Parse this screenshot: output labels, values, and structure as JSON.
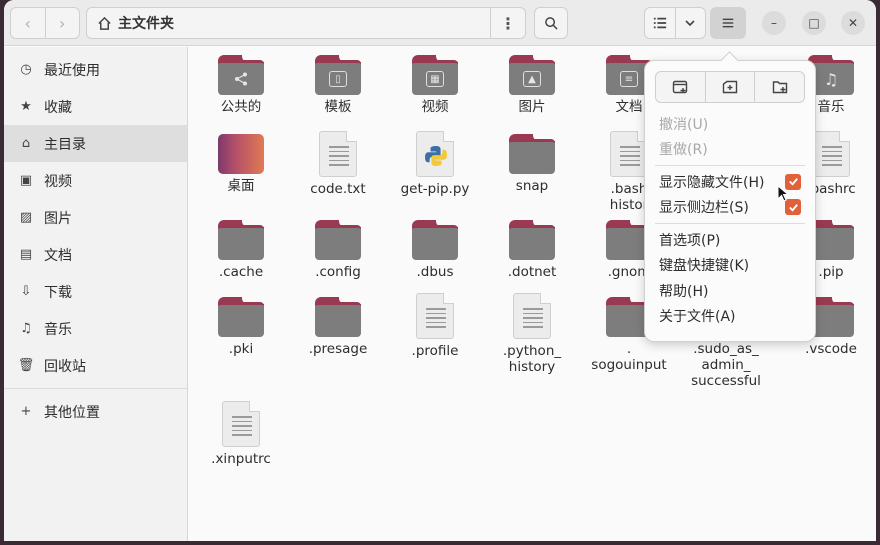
{
  "header": {
    "back_icon": "chevron-left-icon",
    "forward_icon": "chevron-right-icon",
    "path_title": "主文件夹",
    "path_more": "⋮",
    "search_icon": "search-icon",
    "view_icon": "list-view-icon",
    "view_dropdown_icon": "chevron-down-icon",
    "menu_icon": "hamburger-icon",
    "minimize": "–",
    "maximize": "□",
    "close": "✕"
  },
  "sidebar": {
    "items": [
      {
        "label": "最近使用",
        "icon": "clock-icon",
        "glyph": "◷"
      },
      {
        "label": "收藏",
        "icon": "star-icon",
        "glyph": "★"
      },
      {
        "label": "主目录",
        "icon": "home-icon",
        "glyph": "⌂"
      },
      {
        "label": "视频",
        "icon": "video-icon",
        "glyph": "▣"
      },
      {
        "label": "图片",
        "icon": "picture-icon",
        "glyph": "▨"
      },
      {
        "label": "文档",
        "icon": "document-icon",
        "glyph": "▤"
      },
      {
        "label": "下载",
        "icon": "download-icon",
        "glyph": "⇩"
      },
      {
        "label": "音乐",
        "icon": "music-icon",
        "glyph": "♫"
      },
      {
        "label": "回收站",
        "icon": "trash-icon",
        "glyph": "🗑"
      }
    ],
    "other": {
      "label": "其他位置",
      "icon": "plus-icon",
      "glyph": "+"
    }
  },
  "files": [
    {
      "name": "公共的",
      "kind": "folder",
      "glyph": "share-icon"
    },
    {
      "name": "模板",
      "kind": "folder",
      "glyph": "template-icon"
    },
    {
      "name": "视频",
      "kind": "folder",
      "glyph": "video-icon"
    },
    {
      "name": "图片",
      "kind": "folder",
      "glyph": "picture-icon"
    },
    {
      "name": "文档",
      "kind": "folder",
      "glyph": "document-icon"
    },
    {
      "name": "音乐",
      "kind": "folder",
      "glyph": "music-icon"
    },
    {
      "name": "桌面",
      "kind": "desktop"
    },
    {
      "name": "code.txt",
      "kind": "doc"
    },
    {
      "name": "get-pip.py",
      "kind": "python"
    },
    {
      "name": "snap",
      "kind": "folder"
    },
    {
      "name": ".bash\nhistor",
      "kind": "doc"
    },
    {
      "name": ".bashrc",
      "kind": "doc"
    },
    {
      "name": ".cache",
      "kind": "folder"
    },
    {
      "name": ".config",
      "kind": "folder"
    },
    {
      "name": ".dbus",
      "kind": "folder"
    },
    {
      "name": ".dotnet",
      "kind": "folder"
    },
    {
      "name": ".gnom",
      "kind": "folder"
    },
    {
      "name": ".pip",
      "kind": "folder"
    },
    {
      "name": ".pki",
      "kind": "folder"
    },
    {
      "name": ".presage",
      "kind": "folder"
    },
    {
      "name": ".profile",
      "kind": "doc"
    },
    {
      "name": ".python_\nhistory",
      "kind": "doc"
    },
    {
      "name": ".\nsogouinput",
      "kind": "folder"
    },
    {
      "name": ".sudo_as_\nadmin_\nsuccessful",
      "kind": "doc"
    },
    {
      "name": ".vscode",
      "kind": "folder"
    },
    {
      "name": ".xinputrc",
      "kind": "doc"
    }
  ],
  "menu": {
    "top_buttons": [
      "new-window-icon",
      "new-tab-icon",
      "new-folder-icon"
    ],
    "undo": "撤消(U)",
    "redo": "重做(R)",
    "show_hidden": "显示隐藏文件(H)",
    "show_sidebar": "显示侧边栏(S)",
    "preferences": "首选项(P)",
    "shortcuts": "键盘快捷键(K)",
    "help": "帮助(H)",
    "about": "关于文件(A)"
  },
  "colors": {
    "accent": "#e0613a",
    "folder_tab": "#9a3a52",
    "folder_body": "#7d7d7d"
  }
}
